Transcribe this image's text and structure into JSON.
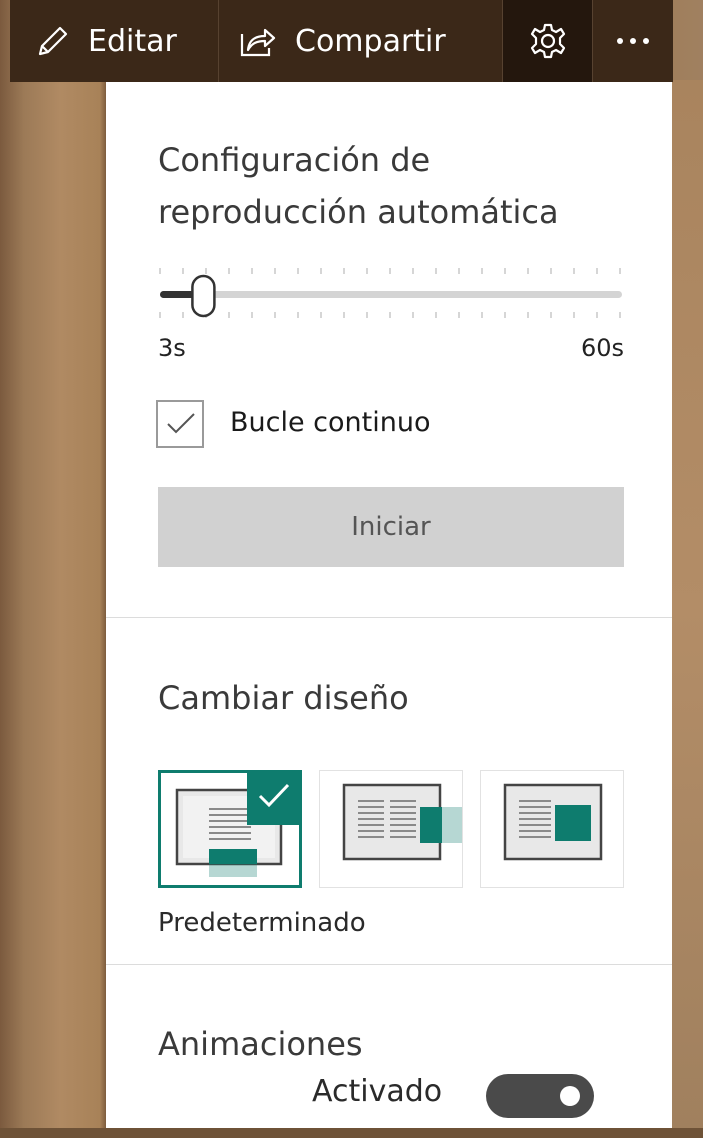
{
  "toolbar": {
    "edit_label": "Editar",
    "share_label": "Compartir",
    "edit_icon": "pencil-icon",
    "share_icon": "share-icon",
    "settings_icon": "gear-icon",
    "more_icon": "more-icon"
  },
  "autoplay": {
    "title": "Configuración de reproducción automática",
    "slider": {
      "min_label": "3s",
      "max_label": "60s",
      "min": 3,
      "max": 60,
      "value": 7
    },
    "loop": {
      "label": "Bucle continuo",
      "checked": true
    },
    "start_label": "Iniciar"
  },
  "layout": {
    "title": "Cambiar diseño",
    "selected_caption": "Predeterminado",
    "options": [
      "default",
      "side-by-side-overlap",
      "side-by-side"
    ],
    "selected_index": 0
  },
  "animations": {
    "title": "Animaciones",
    "toggle_label": "Activado",
    "enabled": true
  },
  "colors": {
    "accent": "#0e7c6e",
    "toolbar_bg": "#3b2818",
    "button_bg": "#d1d1d1"
  }
}
